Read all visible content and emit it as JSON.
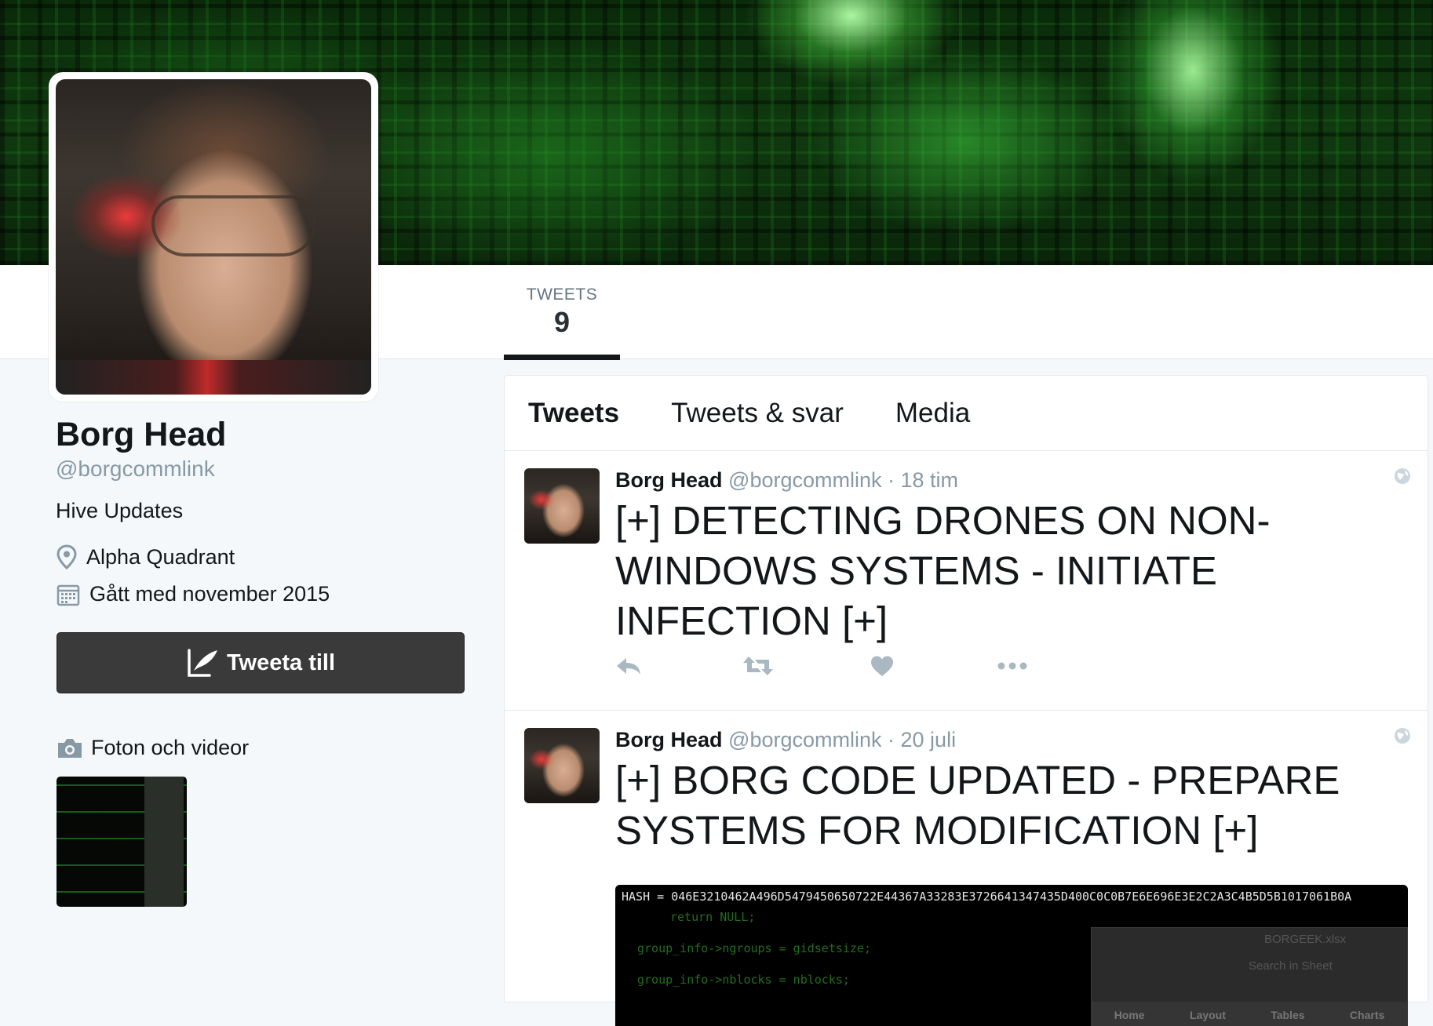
{
  "profile": {
    "name": "Borg Head",
    "handle": "@borgcommlink",
    "bio": "Hive Updates",
    "location": "Alpha Quadrant",
    "joined": "Gått med november 2015",
    "tweet_button_label": "Tweeta till",
    "media_header": "Foton och videor"
  },
  "stats": {
    "tweets_label": "TWEETS",
    "tweets_value": "9"
  },
  "timeline": {
    "tabs": [
      "Tweets",
      "Tweets & svar",
      "Media"
    ],
    "active_tab": "Tweets"
  },
  "tweets": [
    {
      "author": "Borg Head",
      "handle": "@borgcommlink",
      "time": "· 18 tim",
      "text": "[+] DETECTING DRONES ON NON-WINDOWS SYSTEMS - INITIATE INFECTION [+]",
      "actions": [
        "reply-icon",
        "retweet-icon",
        "like-icon",
        "more-icon"
      ]
    },
    {
      "author": "Borg Head",
      "handle": "@borgcommlink",
      "time": "· 20 juli",
      "text": "[+] BORG CODE UPDATED - PREPARE SYSTEMS FOR MODIFICATION [+]",
      "media": {
        "hash_line": "HASH = 046E3210462A496D5479450650722E44367A33283E3726641347435D400C0C0B7E6E696E3E2C2A3C4B5D5B1017061B0A",
        "code_lines": [
          "return NULL;",
          "group_info->ngroups = gidsetsize;",
          "group_info->nblocks = nblocks;"
        ],
        "panel_title": "BORGEEK.xlsx",
        "panel_search": "Search in Sheet",
        "panel_tabs": [
          "Home",
          "Layout",
          "Tables",
          "Charts"
        ]
      }
    }
  ],
  "colors": {
    "accent_dark": "#14171a",
    "muted": "#8899a6",
    "button_bg": "#3a3a3a",
    "icon_gray": "#aab8c2"
  }
}
